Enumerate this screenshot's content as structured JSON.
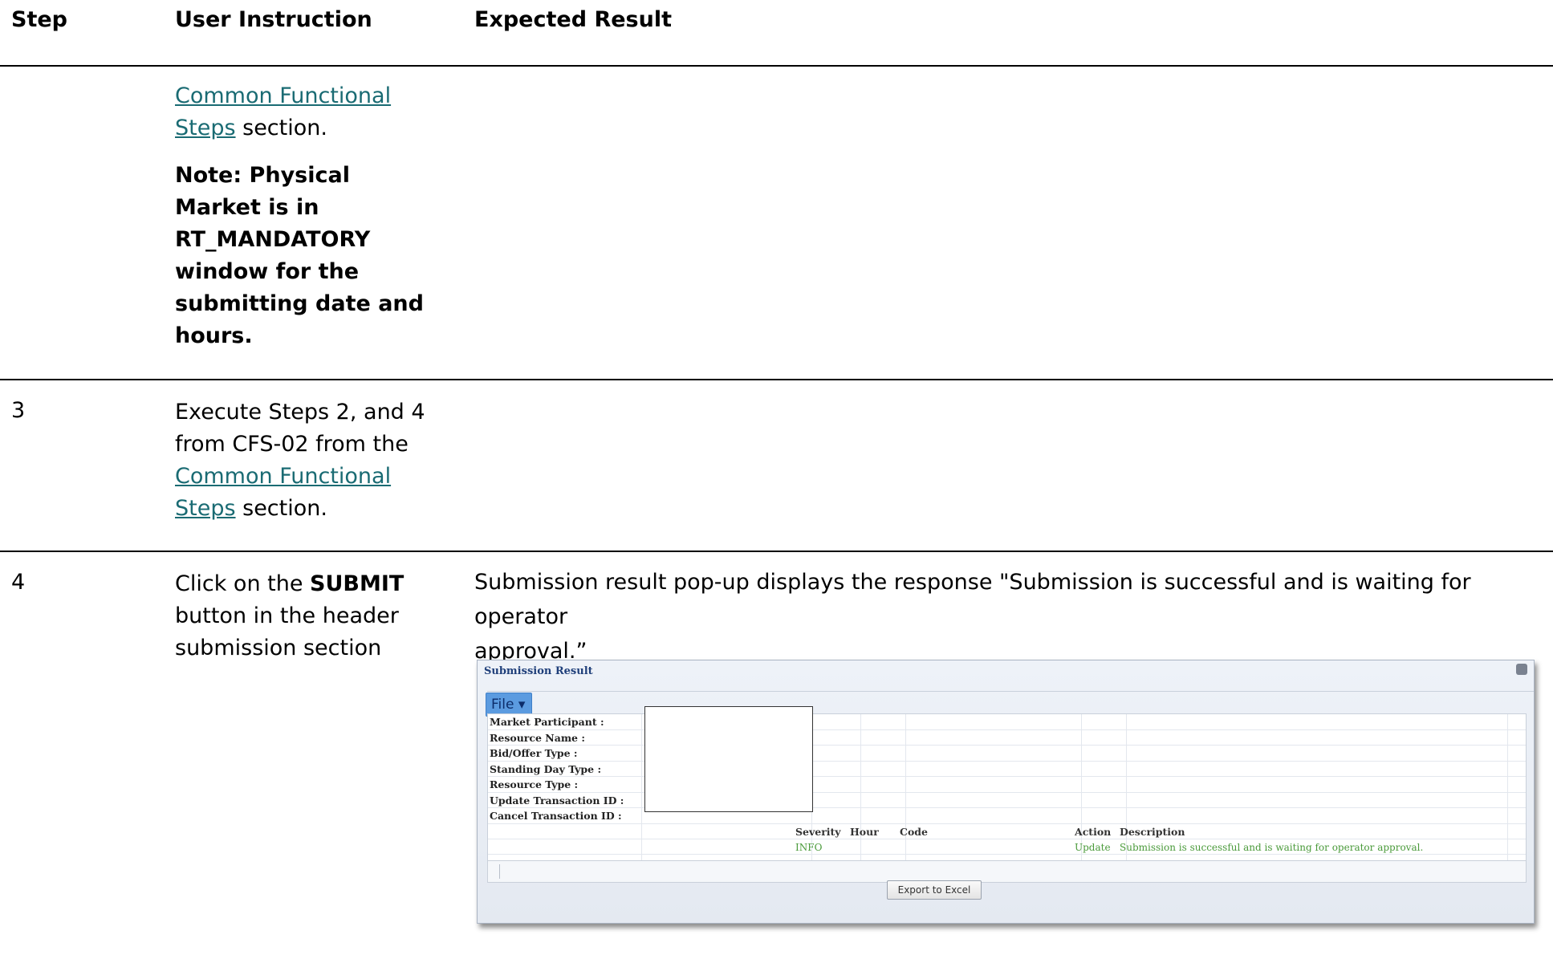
{
  "table": {
    "headers": {
      "step": "Step",
      "instruction": "User Instruction",
      "expected": "Expected Result"
    }
  },
  "row_cont": {
    "link_line1": "Common Functional",
    "link_line2": "Steps",
    "after_link": " section.",
    "note_lines": [
      "Note: Physical",
      "Market is in",
      "RT_MANDATORY",
      "window for the",
      "submitting date and",
      "hours."
    ]
  },
  "row3": {
    "step": "3",
    "line1": "Execute Steps 2, and 4",
    "line2": "from CFS-02 from the",
    "link_line1": "Common Functional",
    "link_line2": "Steps",
    "after_link": " section."
  },
  "row4": {
    "step": "4",
    "instr_pre": "Click on the ",
    "instr_bold": "SUBMIT",
    "instr_line2": "button in the header",
    "instr_line3": "submission section",
    "expected_line1": "Submission result pop-up displays the response \"Submission is successful and is waiting for operator",
    "expected_line2": "approval.”"
  },
  "popup": {
    "title": "Submission Result",
    "file_menu": "File ▾",
    "fields": [
      "Market Participant :",
      "Resource Name :",
      "Bid/Offer Type :",
      "Standing Day Type :",
      "Resource Type :",
      "Update Transaction ID :",
      "Cancel Transaction ID :"
    ],
    "columns": {
      "severity": "Severity",
      "hour": "Hour",
      "code": "Code",
      "action": "Action",
      "description": "Description"
    },
    "message": {
      "severity": "INFO",
      "hour": "",
      "code": "",
      "action": "Update",
      "description": "Submission is successful and is waiting for operator approval."
    },
    "export_button": "Export to Excel"
  }
}
